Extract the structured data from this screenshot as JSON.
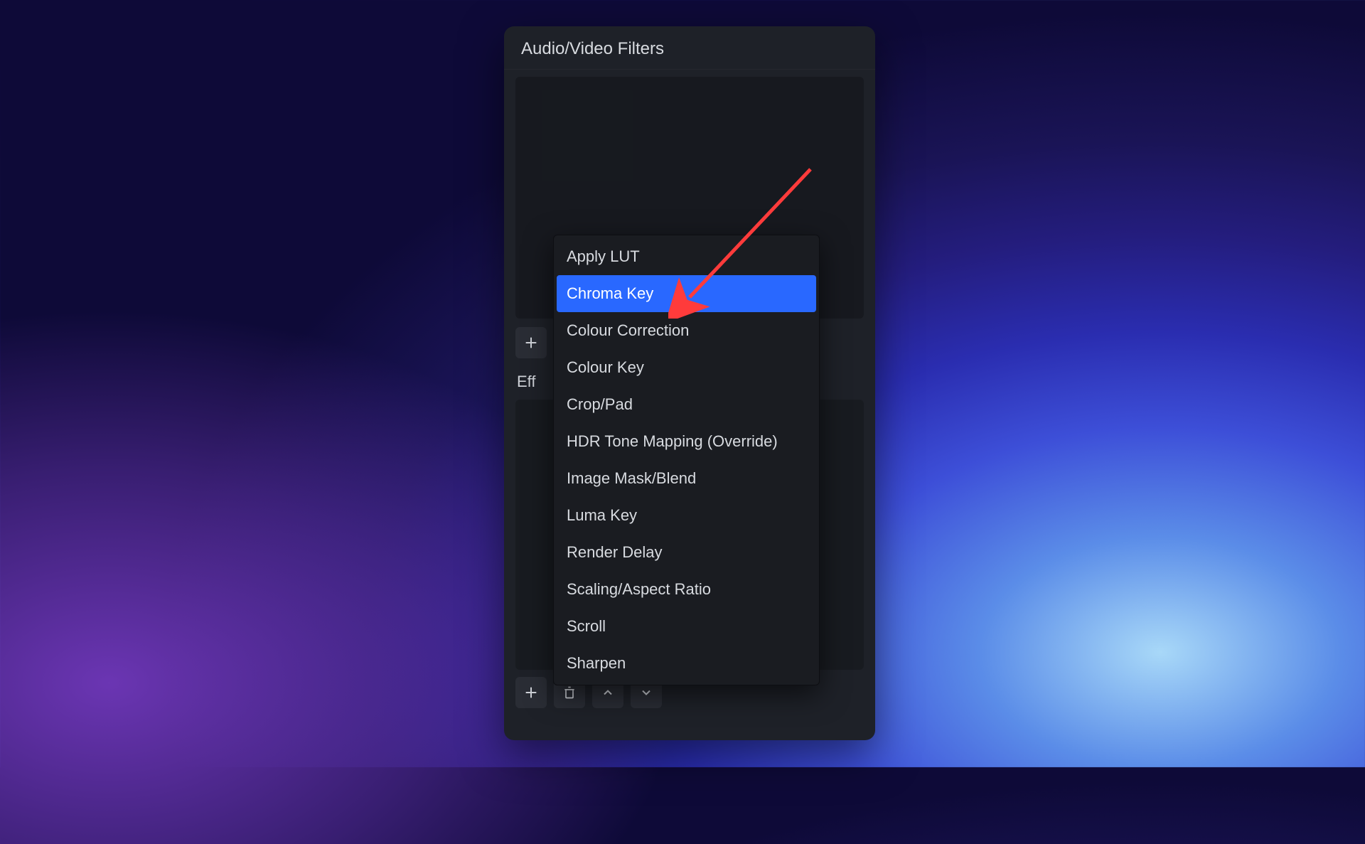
{
  "panel": {
    "title": "Audio/Video Filters",
    "section_label_partial": "Eff"
  },
  "dropdown": {
    "items": [
      {
        "label": "Apply LUT",
        "selected": false
      },
      {
        "label": "Chroma Key",
        "selected": true
      },
      {
        "label": "Colour Correction",
        "selected": false
      },
      {
        "label": "Colour Key",
        "selected": false
      },
      {
        "label": "Crop/Pad",
        "selected": false
      },
      {
        "label": "HDR Tone Mapping (Override)",
        "selected": false
      },
      {
        "label": "Image Mask/Blend",
        "selected": false
      },
      {
        "label": "Luma Key",
        "selected": false
      },
      {
        "label": "Render Delay",
        "selected": false
      },
      {
        "label": "Scaling/Aspect Ratio",
        "selected": false
      },
      {
        "label": "Scroll",
        "selected": false
      },
      {
        "label": "Sharpen",
        "selected": false
      }
    ]
  },
  "annotation": {
    "arrow_color": "#ff3b3b",
    "points_to": "Chroma Key"
  },
  "colors": {
    "panel_bg": "#1e2128",
    "menu_bg": "#1a1c21",
    "highlight": "#2968ff",
    "text": "#d8dbe0"
  }
}
